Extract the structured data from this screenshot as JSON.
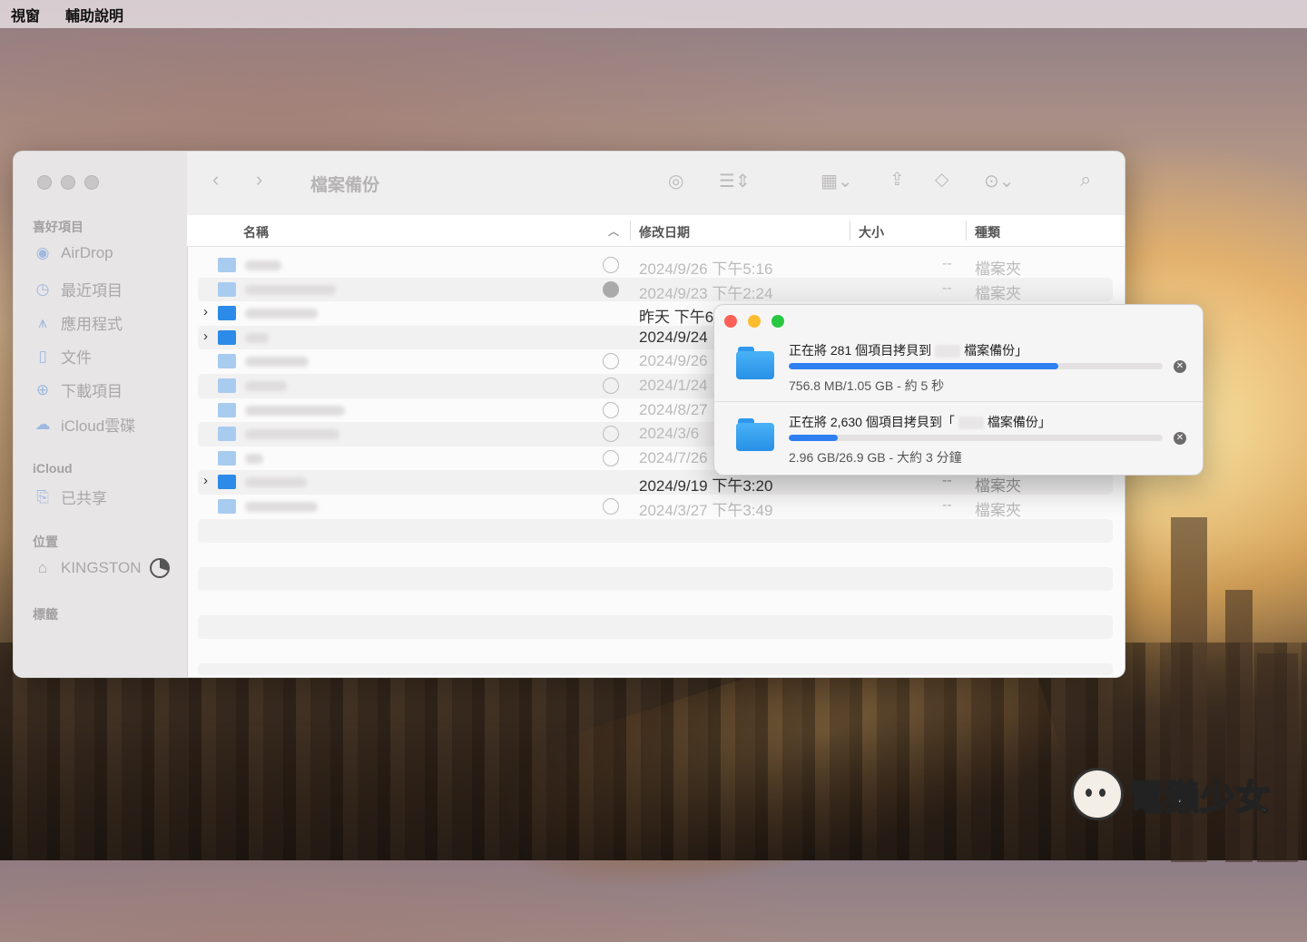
{
  "menubar": {
    "items": [
      "視窗",
      "輔助說明"
    ]
  },
  "finder": {
    "title": "檔案備份",
    "sidebar": {
      "favorites_title": "喜好項目",
      "favorites": [
        {
          "label": "AirDrop",
          "icon": "airdrop-icon"
        },
        {
          "label": "最近項目",
          "icon": "clock-icon"
        },
        {
          "label": "應用程式",
          "icon": "apps-icon"
        },
        {
          "label": "文件",
          "icon": "document-icon"
        },
        {
          "label": "下載項目",
          "icon": "download-icon"
        },
        {
          "label": "iCloud雲碟",
          "icon": "cloud-icon"
        }
      ],
      "icloud_title": "iCloud",
      "icloud_items": [
        {
          "label": "已共享",
          "icon": "shared-folder-icon"
        }
      ],
      "locations_title": "位置",
      "locations": [
        {
          "label": "KINGSTON",
          "icon": "drive-icon"
        }
      ],
      "tags_title": "標籤"
    },
    "columns": {
      "name": "名稱",
      "date": "修改日期",
      "size": "大小",
      "kind": "種類"
    },
    "rows": [
      {
        "date": "2024/9/26 下午5:16",
        "size": "--",
        "kind": "檔案夾",
        "expandable": false,
        "icloud": true,
        "strong": false
      },
      {
        "date": "2024/9/23 下午2:24",
        "size": "--",
        "kind": "檔案夾",
        "expandable": false,
        "icloud": true,
        "strong": false
      },
      {
        "date": "昨天 下午6",
        "size": "",
        "kind": "",
        "expandable": true,
        "icloud": false,
        "strong": true
      },
      {
        "date": "2024/9/24",
        "size": "",
        "kind": "",
        "expandable": true,
        "icloud": false,
        "strong": true
      },
      {
        "date": "2024/9/26",
        "size": "",
        "kind": "",
        "expandable": false,
        "icloud": true,
        "strong": false
      },
      {
        "date": "2024/1/24",
        "size": "",
        "kind": "",
        "expandable": false,
        "icloud": true,
        "strong": false
      },
      {
        "date": "2024/8/27",
        "size": "",
        "kind": "",
        "expandable": false,
        "icloud": true,
        "strong": false
      },
      {
        "date": "2024/3/6",
        "size": "",
        "kind": "",
        "expandable": false,
        "icloud": true,
        "strong": false
      },
      {
        "date": "2024/7/26",
        "size": "",
        "kind": "",
        "expandable": false,
        "icloud": true,
        "strong": false
      },
      {
        "date": "2024/9/19 下午3:20",
        "size": "--",
        "kind": "檔案夾",
        "expandable": true,
        "icloud": false,
        "strong": true
      },
      {
        "date": "2024/3/27 下午3:49",
        "size": "--",
        "kind": "檔案夾",
        "expandable": false,
        "icloud": true,
        "strong": false
      }
    ]
  },
  "copy_panel": {
    "jobs": [
      {
        "title_prefix": "正在將 281 個項目拷貝到",
        "title_suffix": "檔案備份」",
        "info": "756.8 MB/1.05 GB - 約 5 秒",
        "progress": 0.72
      },
      {
        "title_prefix": "正在將 2,630 個項目拷貝到「",
        "title_suffix": "檔案備份」",
        "info": "2.96 GB/26.9 GB - 大約 3 分鐘",
        "progress": 0.13
      }
    ]
  },
  "watermark": {
    "text": "電獺少女"
  },
  "colors": {
    "accent": "#2e7ff0",
    "folder": "#2c8be8",
    "close": "#fe5f57",
    "minimize": "#febc2e",
    "zoom": "#28c840"
  }
}
